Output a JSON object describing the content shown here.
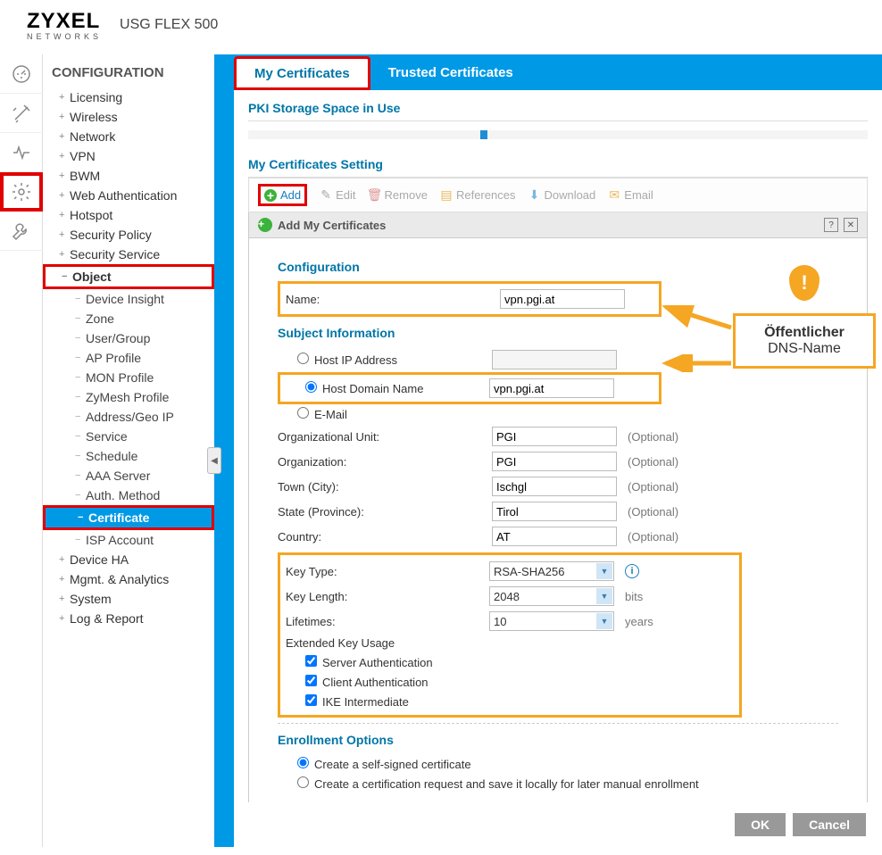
{
  "header": {
    "brand": "ZYXEL",
    "brand_sub": "NETWORKS",
    "product": "USG FLEX 500"
  },
  "sidebar": {
    "title": "CONFIGURATION",
    "items": [
      {
        "label": "Licensing"
      },
      {
        "label": "Wireless"
      },
      {
        "label": "Network"
      },
      {
        "label": "VPN"
      },
      {
        "label": "BWM"
      },
      {
        "label": "Web Authentication"
      },
      {
        "label": "Hotspot"
      },
      {
        "label": "Security Policy"
      },
      {
        "label": "Security Service"
      },
      {
        "label": "Object",
        "expanded": true
      },
      {
        "label": "Device HA"
      },
      {
        "label": "Mgmt. & Analytics"
      },
      {
        "label": "System"
      },
      {
        "label": "Log & Report"
      }
    ],
    "object_children": [
      {
        "label": "Device Insight"
      },
      {
        "label": "Zone"
      },
      {
        "label": "User/Group"
      },
      {
        "label": "AP Profile"
      },
      {
        "label": "MON Profile"
      },
      {
        "label": "ZyMesh Profile"
      },
      {
        "label": "Address/Geo IP"
      },
      {
        "label": "Service"
      },
      {
        "label": "Schedule"
      },
      {
        "label": "AAA Server"
      },
      {
        "label": "Auth. Method"
      },
      {
        "label": "Certificate",
        "selected": true
      },
      {
        "label": "ISP Account"
      }
    ]
  },
  "tabs": {
    "active": "My Certificates",
    "other": "Trusted Certificates"
  },
  "storage_title": "PKI Storage Space in Use",
  "table_title": "My Certificates Setting",
  "toolbar": {
    "add": "Add",
    "edit": "Edit",
    "remove": "Remove",
    "references": "References",
    "download": "Download",
    "email": "Email"
  },
  "dialog": {
    "title": "Add My Certificates"
  },
  "form": {
    "config_section": "Configuration",
    "name_label": "Name:",
    "name_value": "vpn.pgi.at",
    "subject_section": "Subject Information",
    "host_ip_label": "Host IP Address",
    "host_domain_label": "Host Domain Name",
    "host_domain_value": "vpn.pgi.at",
    "email_label": "E-Mail",
    "org_unit_label": "Organizational Unit:",
    "org_unit_value": "PGI",
    "org_label": "Organization:",
    "org_value": "PGI",
    "town_label": "Town (City):",
    "town_value": "Ischgl",
    "state_label": "State (Province):",
    "state_value": "Tirol",
    "country_label": "Country:",
    "country_value": "AT",
    "optional": "(Optional)",
    "key_type_label": "Key Type:",
    "key_type_value": "RSA-SHA256",
    "key_length_label": "Key Length:",
    "key_length_value": "2048",
    "key_length_suffix": "bits",
    "lifetimes_label": "Lifetimes:",
    "lifetimes_value": "10",
    "lifetimes_suffix": "years",
    "eku_label": "Extended Key Usage",
    "eku_server": "Server Authentication",
    "eku_client": "Client Authentication",
    "eku_ike": "IKE Intermediate",
    "enroll_section": "Enrollment Options",
    "enroll_self": "Create a self-signed certificate",
    "enroll_req": "Create a certification request and save it locally for later manual enrollment"
  },
  "callout": {
    "line1": "Öffentlicher",
    "line2": "DNS-Name"
  },
  "buttons": {
    "ok": "OK",
    "cancel": "Cancel"
  }
}
